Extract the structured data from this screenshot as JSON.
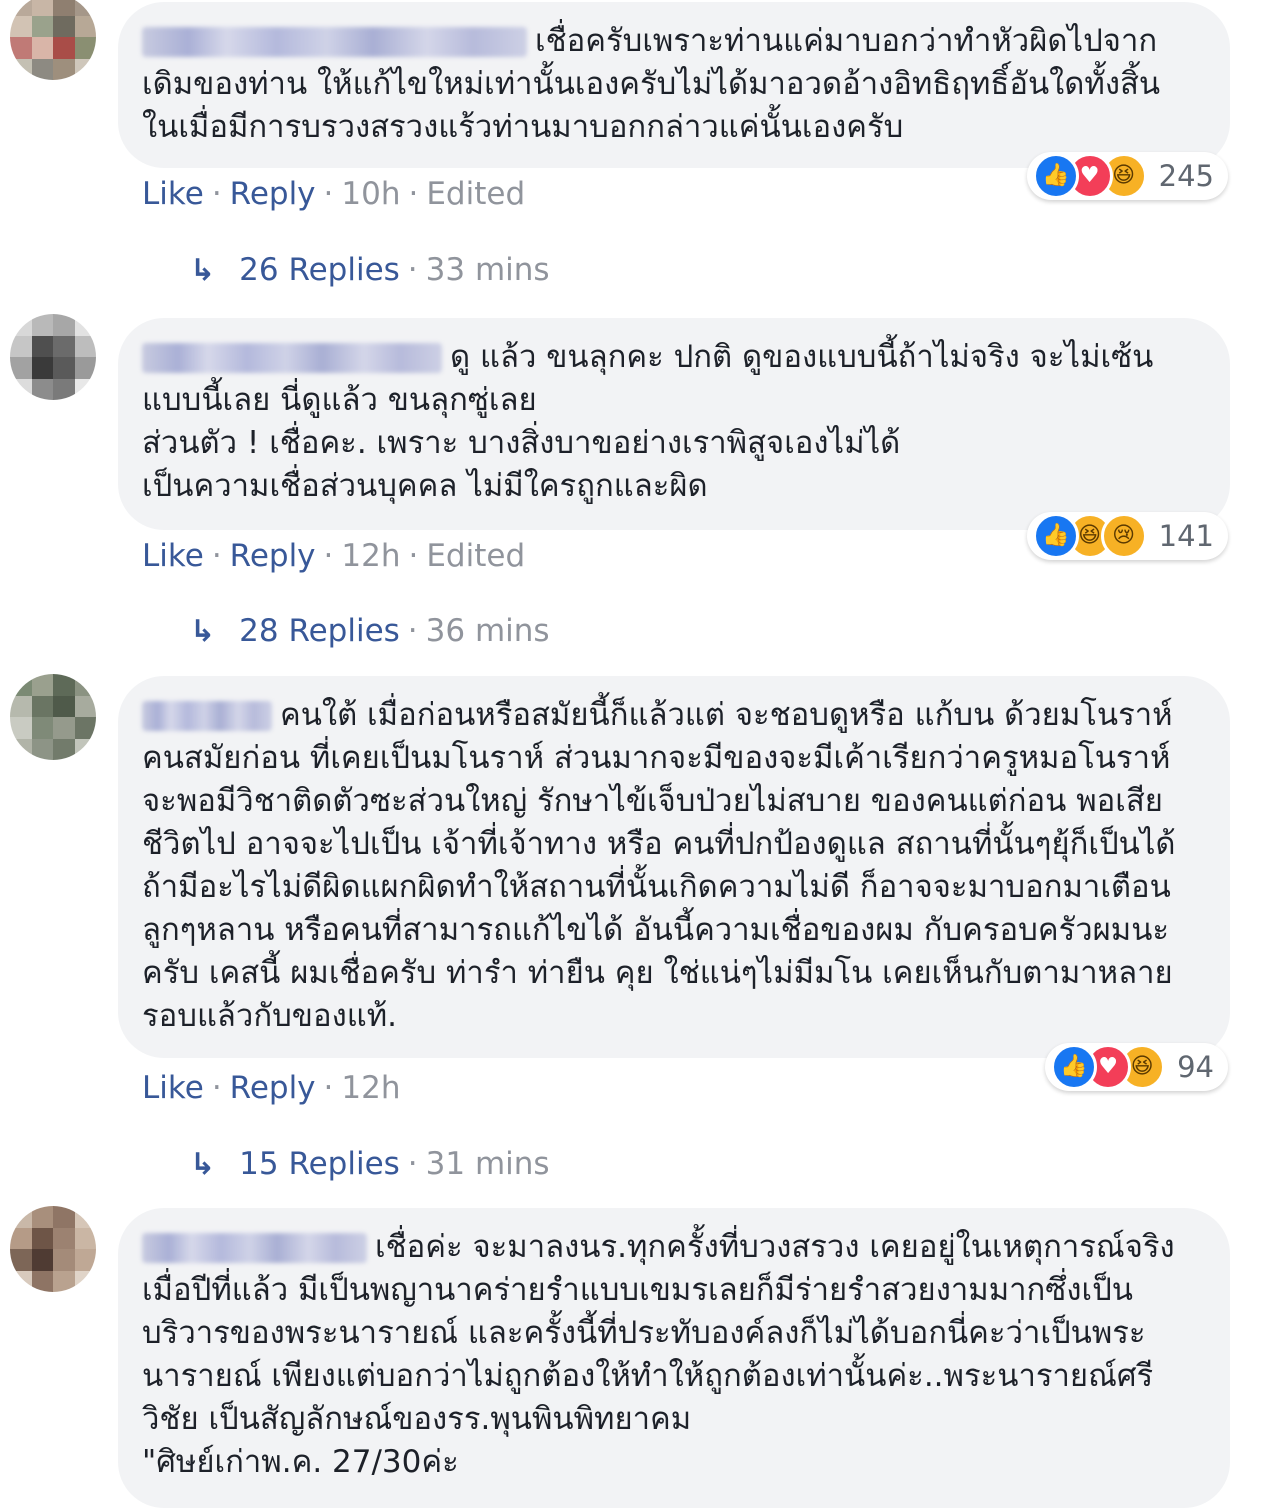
{
  "comments": [
    {
      "text": "เชื่อครับเพราะท่านแค่มาบอกว่าทำหัวผิดไปจากเดิมของท่าน ให้แก้ไขใหม่เท่านั้นเองครับไม่ได้มาอวดอ้างอิทธิฤทธิ์อันใดทั้งสิ้น ในเมื่อมีการบรวงสรวงแร้วท่านมาบอกกล่าวแค่นั้นเองครับ",
      "reactions": {
        "icons": [
          "like-icon",
          "love-icon",
          "haha-icon"
        ],
        "count": "245"
      },
      "actions": {
        "like": "Like",
        "reply": "Reply",
        "time": "10h",
        "edited": "Edited"
      },
      "replies": {
        "count": "26 Replies",
        "time": "33 mins"
      },
      "avatar_colors": [
        "#b9a99a",
        "#c8b6a6",
        "#8f7f70",
        "#a59789",
        "#d2c3b4",
        "#9aa28c",
        "#6f6b5f",
        "#b7a896",
        "#c07a76",
        "#d9b5a8",
        "#a94d48",
        "#8a8f72",
        "#c4c0b3",
        "#8d8a82",
        "#9e8f7d",
        "#cfc7bb"
      ]
    },
    {
      "text": "ดู แล้ว ขนลุกคะ ปกติ ดูของแบบนี้ถ้าไม่จริง จะไม่เซ้นแบบนี้เลย นี่ดูแล้ว ขนลุกซู่เลย\nส่วนตัว ! เชื่อคะ. เพราะ บางสิ่งบาขอย่างเราพิสูจเองไม่ได้\nเป็นความเชื่อส่วนบุคคล ไม่มีใครถูกและผิด",
      "reactions": {
        "icons": [
          "like-icon",
          "haha-icon",
          "sad-icon"
        ],
        "count": "141"
      },
      "actions": {
        "like": "Like",
        "reply": "Reply",
        "time": "12h",
        "edited": "Edited"
      },
      "replies": {
        "count": "28 Replies",
        "time": "36 mins"
      },
      "avatar_colors": [
        "#d8d8d8",
        "#b9b9b9",
        "#a7a7a7",
        "#e2e2e2",
        "#c6c6c6",
        "#4f4f4f",
        "#6b6b6b",
        "#bdbdbd",
        "#a2a2a2",
        "#3a3a3a",
        "#5a5a5a",
        "#9a9a9a",
        "#dcdcdc",
        "#8c8c8c",
        "#7a7a7a",
        "#e8e8e8"
      ]
    },
    {
      "text": "คนใต้ เมื่อก่อนหรือสมัยนี้ก็แล้วแต่ จะชอบดูหรือ แก้บน ด้วยมโนราห์ คนสมัยก่อน ที่เคยเป็นมโนราห์ ส่วนมากจะมีของจะมีเค้าเรียกว่าครูหมอโนราห์ จะพอมีวิชาติดตัวซะส่วนใหญ่ รักษาไข้เจ็บป่วยไม่สบาย ของคนแต่ก่อน พอเสียชีวิตไป อาจจะไปเป็น เจ้าที่เจ้าทาง หรือ คนที่ปกป้องดูแล สถานที่นั้นๆยุ้ก็เป็นได้ ถ้ามีอะไรไม่ดีผิดแผกผิดทำให้สถานที่นั้นเกิดความไม่ดี ก็อาจจะมาบอกมาเตือน ลูกๆหลาน หรือคนที่สามารถแก้ไขได้ อันนี้ความเชื่อของผม กับครอบครัวผมนะครับ เคสนี้ ผมเชื่อครับ ท่ารำ ท่ายืน คุย ใช่แน่ๆไม่มีมโน เคยเห็นกับตามาหลายรอบแล้วกับของแท้.",
      "reactions": {
        "icons": [
          "like-icon",
          "love-icon",
          "haha-icon"
        ],
        "count": "94"
      },
      "actions": {
        "like": "Like",
        "reply": "Reply",
        "time": "12h",
        "edited": ""
      },
      "replies": {
        "count": "15 Replies",
        "time": "31 mins"
      },
      "avatar_colors": [
        "#7b8a74",
        "#9aa08e",
        "#5e6a58",
        "#8b9382",
        "#b6b9ad",
        "#6a7563",
        "#4f5a4a",
        "#a7ab9e",
        "#c9cbc2",
        "#7f8a78",
        "#959a8c",
        "#6c7565",
        "#b1b4a8",
        "#8d9486",
        "#727b6b",
        "#c2c5bb"
      ]
    },
    {
      "text": "เชื่อค่ะ จะมาลงนร.ทุกครั้งที่บวงสรวง เคยอยู่ในเหตุการณ์จริงเมื่อปีที่แล้ว มีเป็นพญานาคร่ายรำแบบเขมรเลยก็มีร่ายรำสวยงามมากซึ่งเป็นบริวารของพระนารายณ์ และครั้งนี้ที่ประทับองค์ลงก็ไม่ได้บอกนี่คะว่าเป็นพระนารายณ์ เพียงแต่บอกว่าไม่ถูกต้องให้ทำให้ถูกต้องเท่านั้นค่ะ..พระนารายณ์ศรีวิชัย เป็นสัญลักษณ์ของรร.พุนพินพิทยาคม\n\"ศิษย์เก่าพ.ค. 27/30ค่ะ",
      "reactions": null,
      "actions": null,
      "replies": null,
      "avatar_colors": [
        "#c9b8a8",
        "#a88f7c",
        "#8f7565",
        "#d6c6b7",
        "#b59b87",
        "#6e5547",
        "#9c8271",
        "#cab6a4",
        "#7d6657",
        "#4f3b33",
        "#a48b79",
        "#bfa895",
        "#d8cabd",
        "#8e7464",
        "#b9a28f",
        "#e0d4c8"
      ]
    }
  ]
}
